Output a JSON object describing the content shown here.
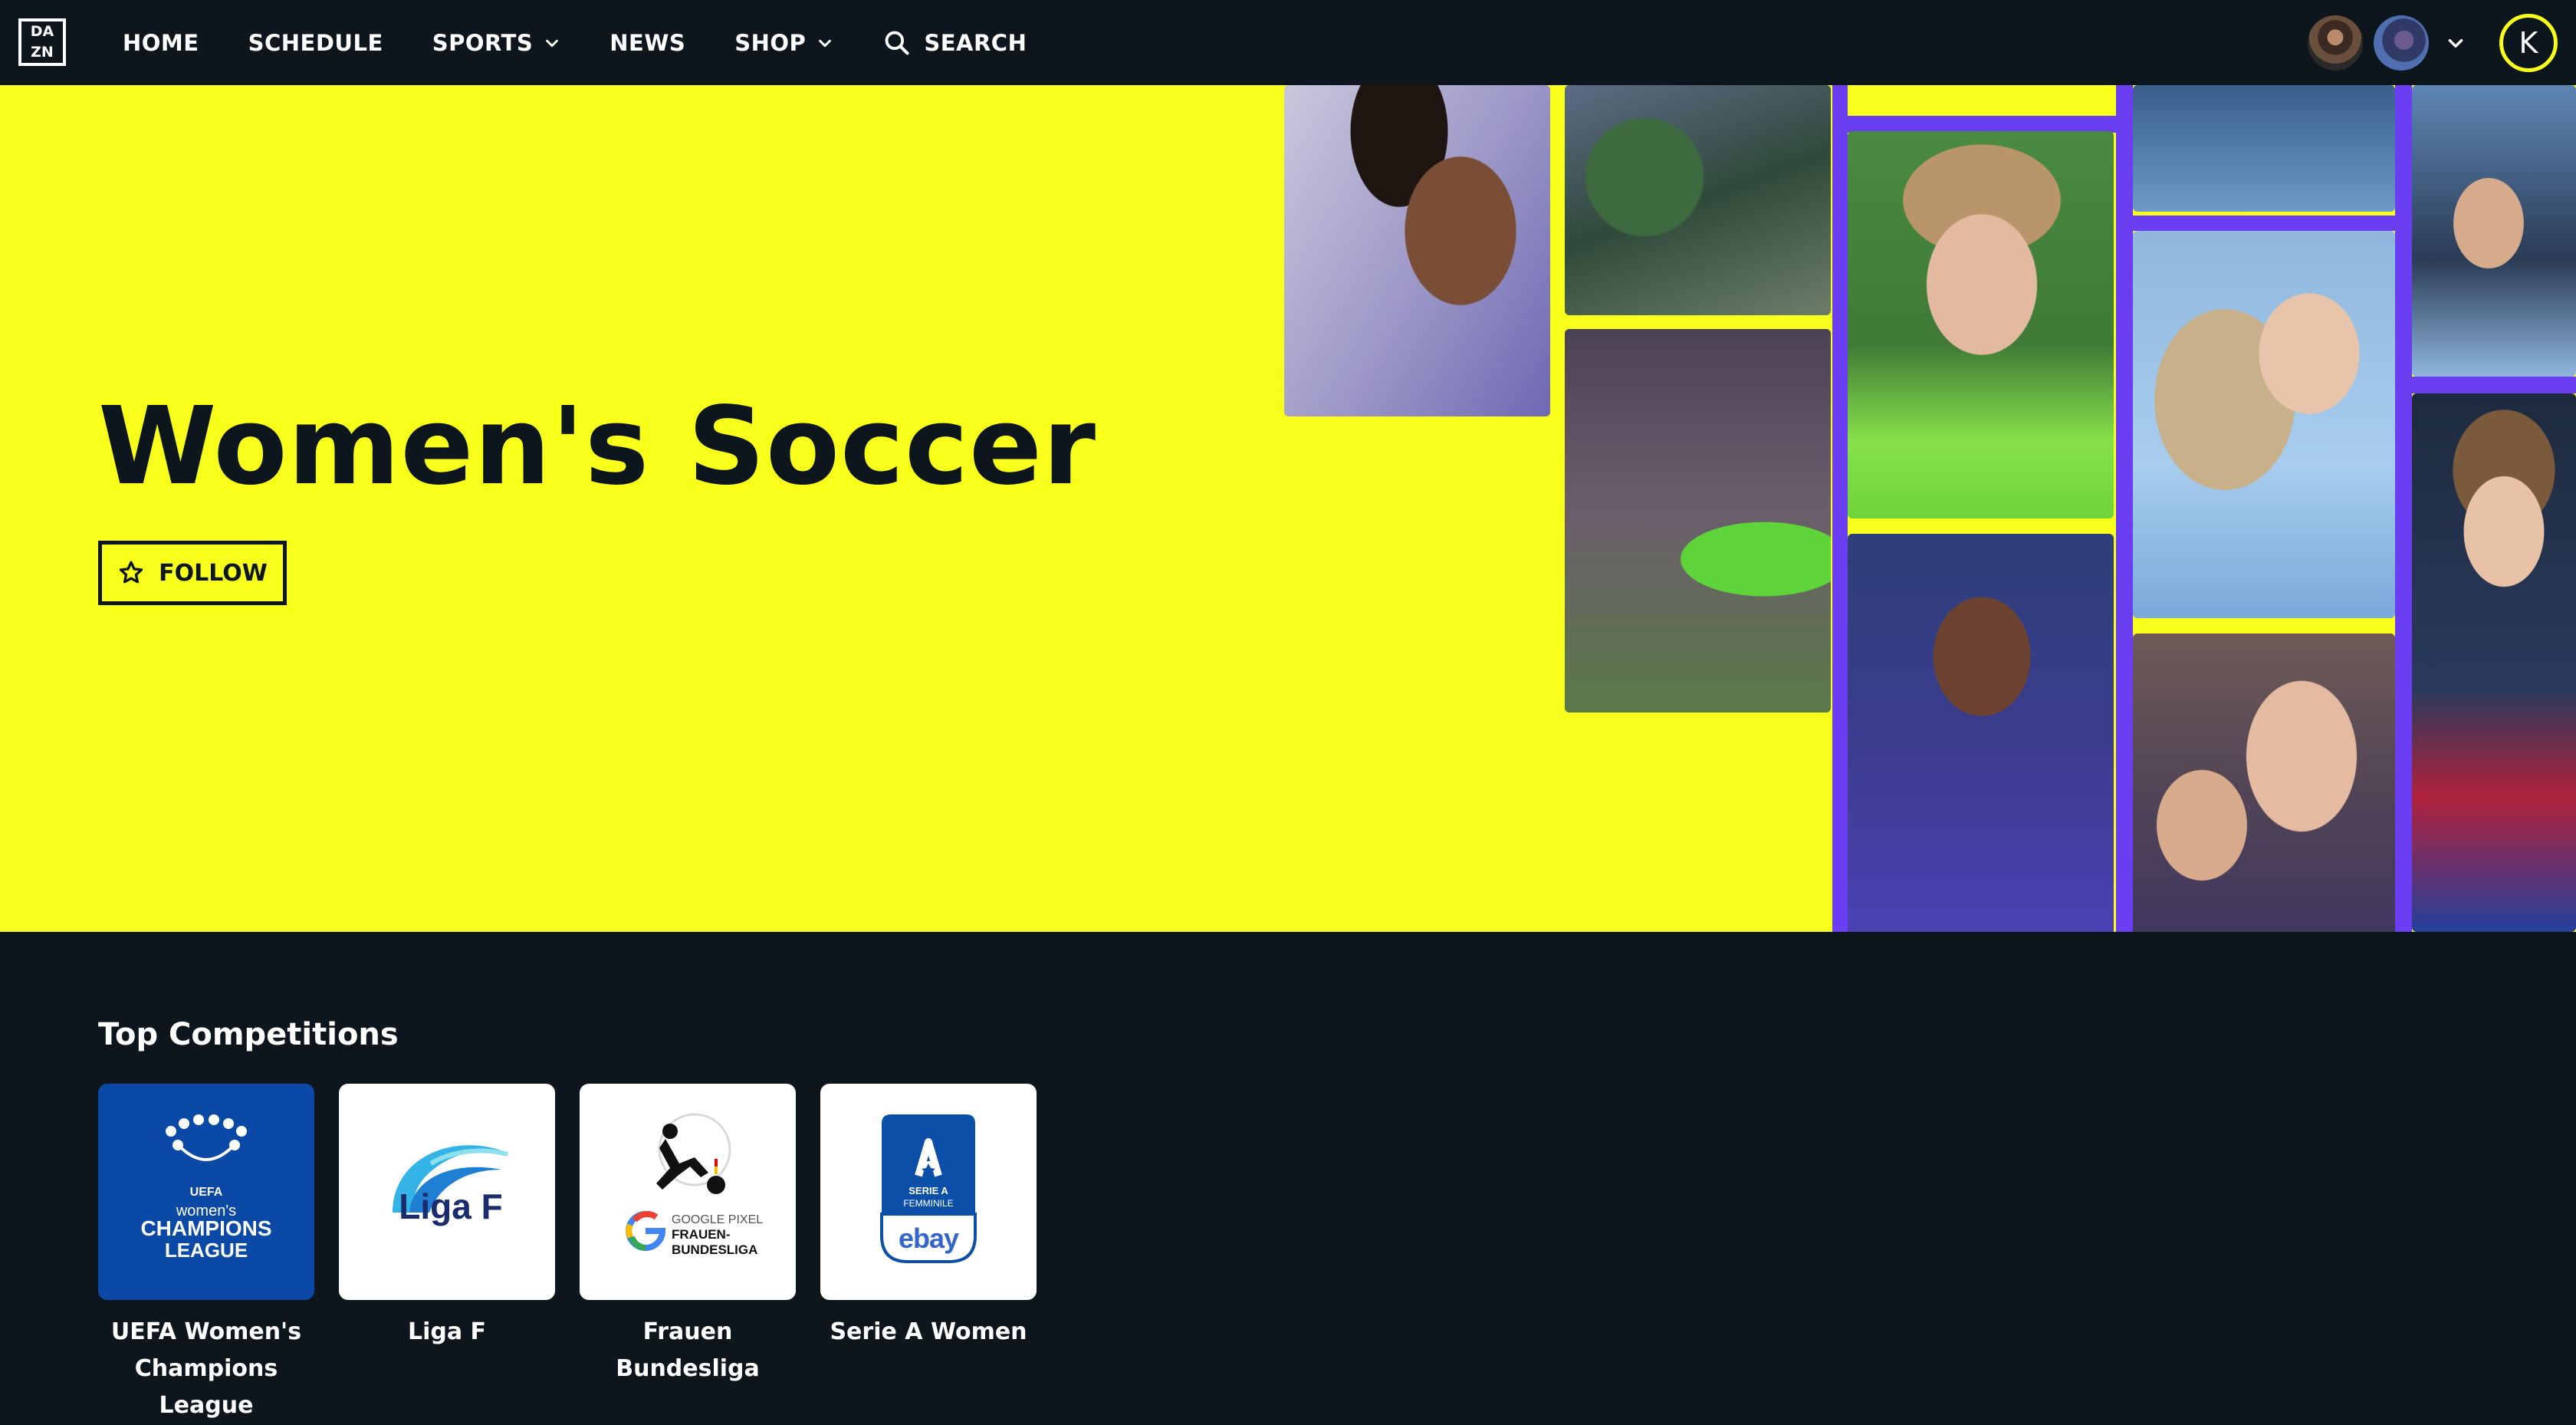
{
  "nav": {
    "logo": [
      "DA",
      "ZN"
    ],
    "items": [
      {
        "label": "HOME",
        "dropdown": false
      },
      {
        "label": "SCHEDULE",
        "dropdown": false
      },
      {
        "label": "SPORTS",
        "dropdown": true
      },
      {
        "label": "NEWS",
        "dropdown": false
      },
      {
        "label": "SHOP",
        "dropdown": true
      }
    ],
    "search_label": "SEARCH",
    "profile_initial": "K"
  },
  "hero": {
    "title": "Women's Soccer",
    "follow_label": "FOLLOW"
  },
  "competitions": {
    "title": "Top Competitions",
    "items": [
      {
        "name": "UEFA Women's Champions League",
        "logo_text": [
          "UEFA",
          "women's",
          "CHAMPIONS",
          "LEAGUE"
        ]
      },
      {
        "name": "Liga F",
        "logo_text": [
          "Liga F"
        ]
      },
      {
        "name": "Frauen Bundesliga",
        "logo_text": [
          "GOOGLE PIXEL",
          "FRAUEN-",
          "BUNDESLIGA"
        ]
      },
      {
        "name": "Serie A Women",
        "logo_text": [
          "SERIE A",
          "FEMMINILE",
          "ebay"
        ]
      }
    ]
  },
  "colors": {
    "background": "#0c161c",
    "hero_yellow": "#f7ff1a",
    "accent_purple": "#6a3ff2",
    "uwcl_blue": "#0a4aa6"
  }
}
